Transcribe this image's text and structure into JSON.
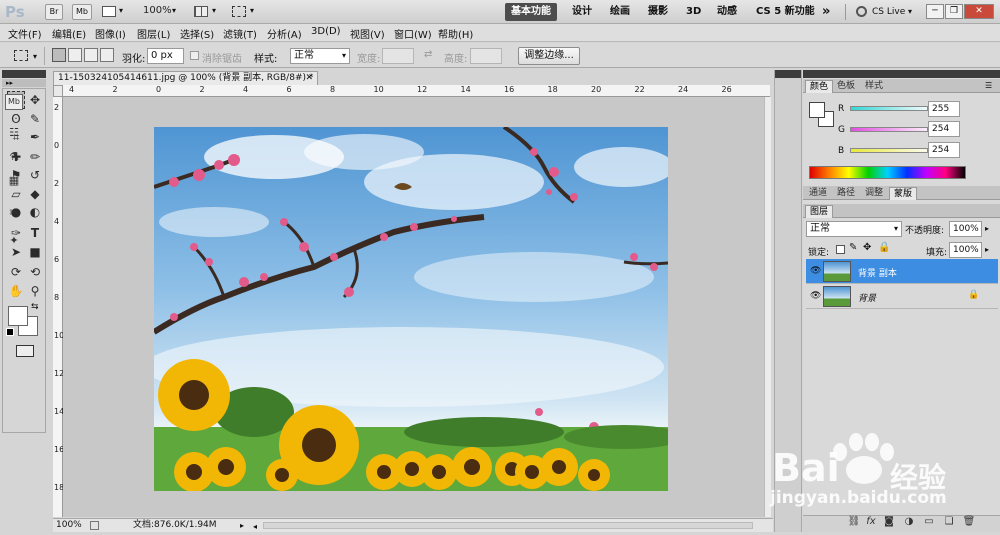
{
  "appbar": {
    "logo": "Ps",
    "bridge": "Br",
    "minibridge": "Mb",
    "zoom": "100%",
    "workspaces": [
      "基本功能",
      "设计",
      "绘画",
      "摄影",
      "3D",
      "动感",
      "CS 5 新功能"
    ],
    "more": "»",
    "cslive": "CS Live",
    "colors": {
      "active_ws_bg": "#4d4d4d",
      "active_ws_text": "#ffffff"
    }
  },
  "menus": [
    "文件(F)",
    "编辑(E)",
    "图像(I)",
    "图层(L)",
    "选择(S)",
    "滤镜(T)",
    "分析(A)",
    "3D(D)",
    "视图(V)",
    "窗口(W)",
    "帮助(H)"
  ],
  "options": {
    "feather_label": "羽化:",
    "feather_value": "0 px",
    "antialias_label": "消除锯齿",
    "style_label": "样式:",
    "style_value": "正常",
    "width_label": "宽度:",
    "height_label": "高度:",
    "refine_button": "调整边缘..."
  },
  "document": {
    "tab_title": "11-150324105414611.jpg @ 100% (背景 副本, RGB/8#) *",
    "ruler_h": [
      "4",
      "2",
      "0",
      "2",
      "4",
      "6",
      "8",
      "10",
      "12",
      "14",
      "16",
      "18",
      "20",
      "22",
      "24",
      "26"
    ],
    "ruler_v": [
      "2",
      "0",
      "2",
      "4",
      "6",
      "8",
      "10",
      "12",
      "14",
      "16",
      "18"
    ]
  },
  "status": {
    "zoom": "100%",
    "doc_info": "文档:876.0K/1.94M"
  },
  "color_panel": {
    "tabs": [
      "颜色",
      "色板",
      "样式"
    ],
    "r_label": "R",
    "r_value": "255",
    "g_label": "G",
    "g_value": "254",
    "b_label": "B",
    "b_value": "254",
    "colors": {
      "r_track": "#35d6d6",
      "g_track": "#e24ee2",
      "b_track": "#e8e83c"
    }
  },
  "adjust_tabs": [
    "通道",
    "路径",
    "调整",
    "蒙版"
  ],
  "layers_panel": {
    "tab": "图层",
    "blend_mode": "正常",
    "opacity_label": "不透明度:",
    "opacity_value": "100%",
    "lock_label": "锁定:",
    "fill_label": "填充:",
    "fill_value": "100%",
    "layers": [
      {
        "name": "背景 副本",
        "selected": true
      },
      {
        "name": "背景",
        "selected": false,
        "locked": true
      }
    ],
    "colors": {
      "selected_bg": "#3d8de2"
    }
  },
  "watermark": {
    "brand": "Bai",
    "brand_cn": "经验",
    "url": "jingyan.baidu.com"
  }
}
